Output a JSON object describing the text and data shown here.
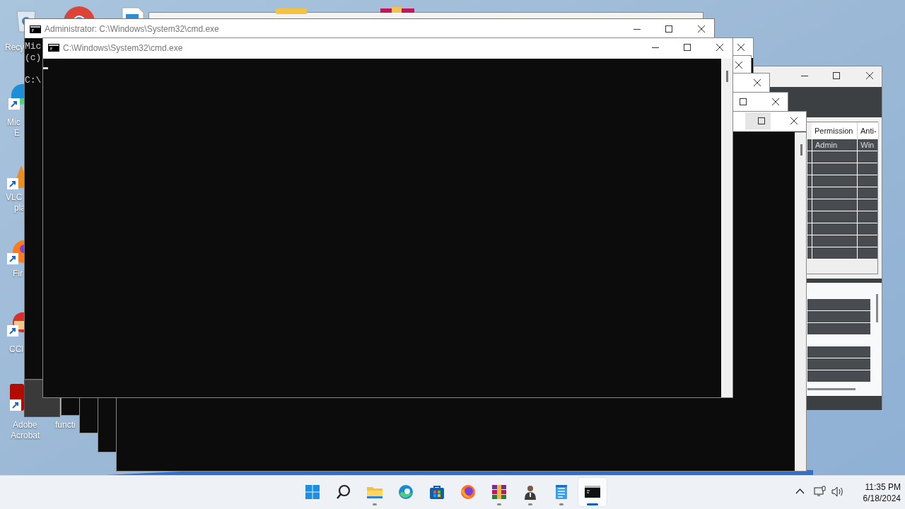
{
  "desktop_icons": [
    {
      "kind": "recycle",
      "lines": [
        "Recy"
      ]
    },
    {
      "kind": "edge",
      "lines": [
        "Mic",
        "E"
      ]
    },
    {
      "kind": "vlc",
      "lines": [
        "VLC",
        "pla"
      ]
    },
    {
      "kind": "firefox",
      "lines": [
        "Fir"
      ]
    },
    {
      "kind": "ccleaner",
      "lines": [
        "CCl"
      ]
    },
    {
      "kind": "acrobat",
      "lines": [
        "Adobe",
        "Acrobat"
      ]
    },
    {
      "kind": "hidden",
      "lines": [
        "functi"
      ]
    }
  ],
  "admin_console": {
    "title": "Administrator: C:\\Windows\\System32\\cmd.exe",
    "lines": [
      "Mic",
      "(c)",
      "C:\\"
    ]
  },
  "front_console": {
    "title": "C:\\Windows\\System32\\cmd.exe"
  },
  "table_window": {
    "columns": [
      "Permission",
      "Anti-"
    ],
    "rows": [
      [
        "Admin",
        "Win"
      ]
    ]
  },
  "taskbar": {
    "apps": [
      {
        "kind": "start",
        "running": false,
        "selected": false
      },
      {
        "kind": "search",
        "running": false,
        "selected": false
      },
      {
        "kind": "folder",
        "running": true,
        "selected": false
      },
      {
        "kind": "edge",
        "running": false,
        "selected": false
      },
      {
        "kind": "store",
        "running": false,
        "selected": false
      },
      {
        "kind": "firefox",
        "running": false,
        "selected": false
      },
      {
        "kind": "archiver",
        "running": true,
        "selected": false
      },
      {
        "kind": "person",
        "running": true,
        "selected": false
      },
      {
        "kind": "notepad",
        "running": true,
        "selected": false
      },
      {
        "kind": "terminal",
        "running": true,
        "selected": true
      }
    ],
    "time": "11:35 PM",
    "date": "6/18/2024"
  }
}
